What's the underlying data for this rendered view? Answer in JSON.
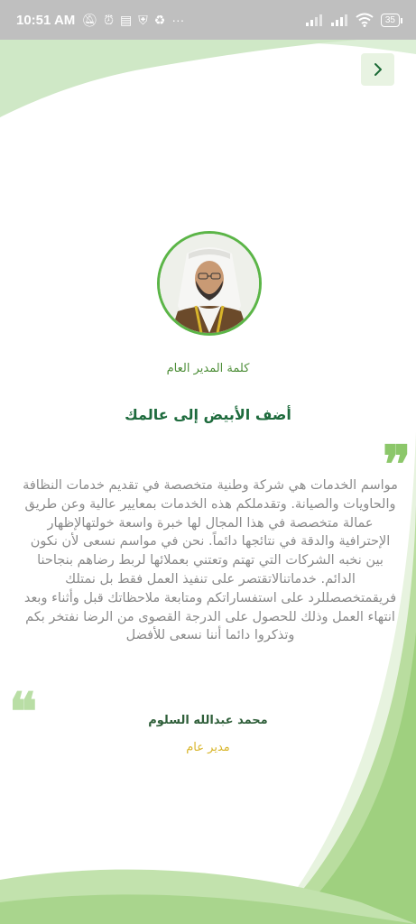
{
  "status_bar": {
    "time": "10:51 AM",
    "battery": "35",
    "left_icons": [
      "bell-off-icon",
      "alarm-icon",
      "message-icon",
      "shield-icon",
      "recycle-icon",
      "more-icon"
    ],
    "right_icons": [
      "signal-icon",
      "signal-icon",
      "wifi-icon",
      "battery-icon"
    ]
  },
  "nav": {
    "back_icon": "chevron-right-icon"
  },
  "profile": {
    "role_title": "كلمة المدير العام",
    "headline": "أضف الأبيض إلى عالمك",
    "message": "مواسم الخدمات هي شركة وطنية متخصصة في تقديم خدمات النظافة والحاويات والصيانة. وتقدملكم هذه الخدمات بمعايير عالية وعن طريق عمالة متخصصة في هذا المجال لها خبرة واسعة خولتهالإظهار الإحترافية والدقة في نتائجها دائماً. نحن في مواسم نسعى لأن نكون بين نخبه الشركات التي تهتم وتعتني بعملائها لربط رضاهم بنجاحنا الدائم. خدماتنالاتقتصر على تنفيذ العمل فقط بل نمتلك فريقمتخصصللرد على استفساراتكم ومتابعة ملاحظاتك قبل وأثناء وبعد انتهاء العمل وذلك للحصول على الدرجة القصوى من الرضا نفتخر بكم وتذكروا دائما أننا نسعى للأفضل",
    "quote_open": "❞",
    "quote_close": "❝",
    "signer_name": "محمد عبدالله السلوم",
    "signer_title": "مدير عام"
  },
  "colors": {
    "accent_green": "#5bb547",
    "dark_green": "#1e6b3d",
    "gold": "#d8b52a",
    "text_gray": "#8a8a8a",
    "back_button_bg": "#e8f3e2"
  }
}
